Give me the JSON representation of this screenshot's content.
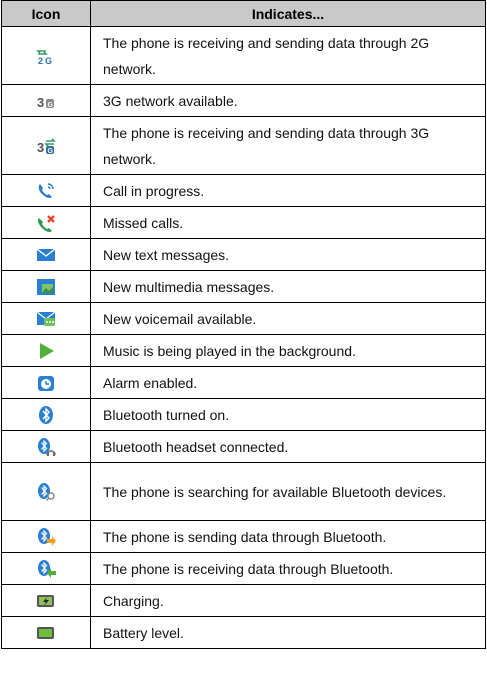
{
  "table": {
    "headers": {
      "icon": "Icon",
      "indicates": "Indicates..."
    },
    "rows": [
      {
        "icon": "data-2g-icon",
        "text": "The phone is receiving and sending data through 2G network."
      },
      {
        "icon": "network-3g-icon",
        "text": "3G network available."
      },
      {
        "icon": "data-3g-icon",
        "text": "The phone is receiving and sending data through 3G network."
      },
      {
        "icon": "call-in-progress-icon",
        "text": "Call in progress."
      },
      {
        "icon": "missed-call-icon",
        "text": "Missed calls."
      },
      {
        "icon": "text-message-icon",
        "text": "New text messages."
      },
      {
        "icon": "multimedia-message-icon",
        "text": "New multimedia messages."
      },
      {
        "icon": "voicemail-icon",
        "text": "New voicemail available."
      },
      {
        "icon": "music-play-icon",
        "text": "Music is being played in the background."
      },
      {
        "icon": "alarm-icon",
        "text": "Alarm enabled."
      },
      {
        "icon": "bluetooth-icon",
        "text": "Bluetooth turned on."
      },
      {
        "icon": "bluetooth-headset-icon",
        "text": "Bluetooth headset connected."
      },
      {
        "icon": "bluetooth-searching-icon",
        "text": "The phone is searching for available Bluetooth devices."
      },
      {
        "icon": "bluetooth-sending-icon",
        "text": "The phone is sending data through Bluetooth."
      },
      {
        "icon": "bluetooth-receiving-icon",
        "text": "The phone is receiving data through Bluetooth."
      },
      {
        "icon": "charging-icon",
        "text": "Charging."
      },
      {
        "icon": "battery-level-icon",
        "text": "Battery level."
      }
    ]
  }
}
